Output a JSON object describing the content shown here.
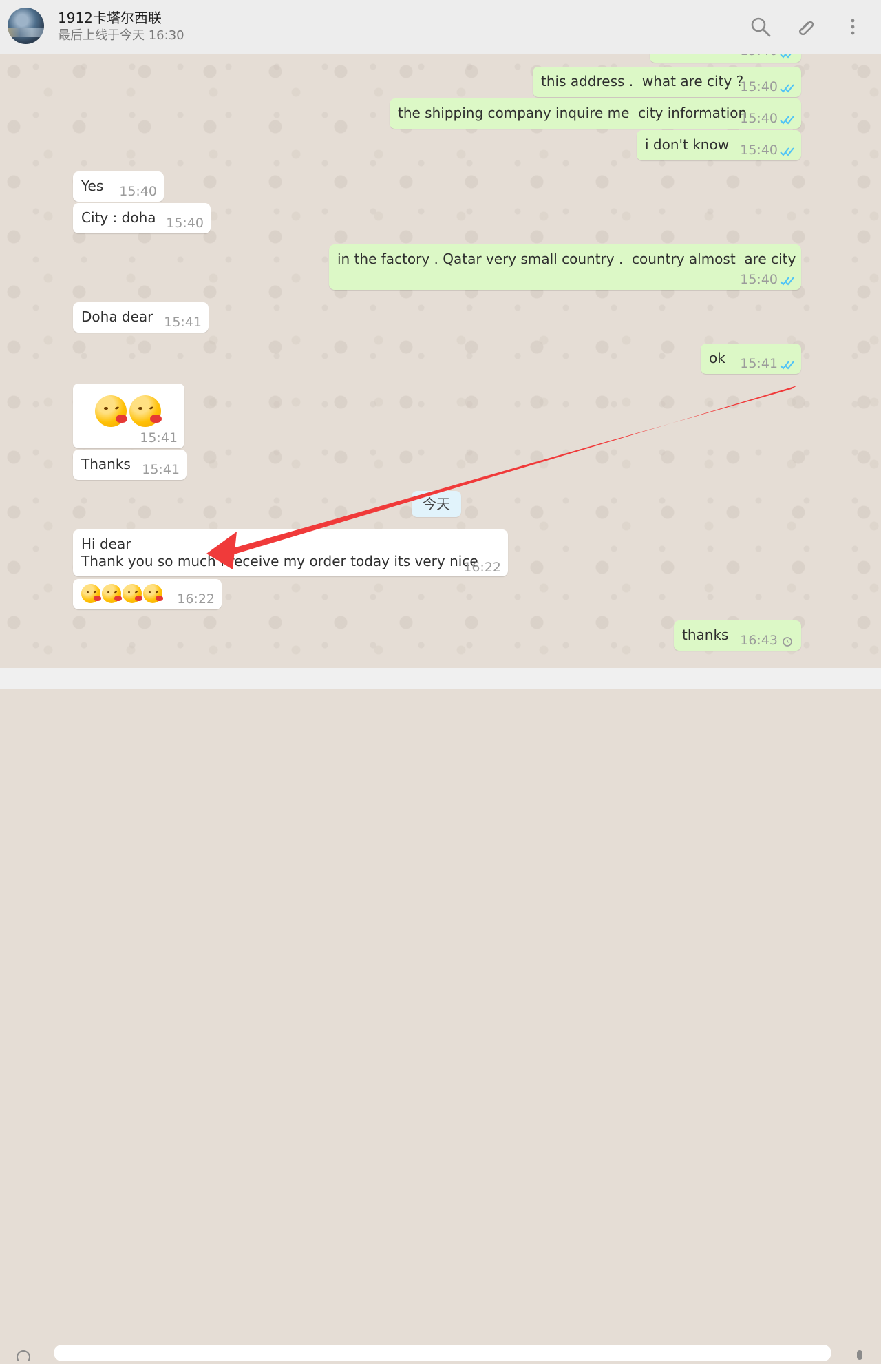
{
  "header": {
    "contact_name": "1912卡塔尔西联",
    "status": "最后上线于今天 16:30",
    "icons": [
      "search-icon",
      "paperclip-icon",
      "more-vertical-icon"
    ]
  },
  "messages": [
    {
      "direction": "outgoing",
      "text": "this address .  what are city ?",
      "time": "15:40",
      "status": "read"
    },
    {
      "direction": "outgoing",
      "text": "the shipping company inquire me  city information",
      "time": "15:40",
      "status": "read"
    },
    {
      "direction": "outgoing",
      "text": "i don't know",
      "time": "15:40",
      "status": "read"
    },
    {
      "direction": "incoming",
      "text": "Yes",
      "time": "15:40"
    },
    {
      "direction": "incoming",
      "text": "City : doha",
      "time": "15:40"
    },
    {
      "direction": "outgoing",
      "text": "in the factory . Qatar very small country .  country almost  are city",
      "time": "15:40",
      "status": "read"
    },
    {
      "direction": "incoming",
      "text": "Doha dear",
      "time": "15:41"
    },
    {
      "direction": "outgoing",
      "text": "ok",
      "time": "15:41",
      "status": "read"
    },
    {
      "direction": "incoming",
      "text": "",
      "time": "15:41",
      "emoji": "kissing-face-emoji x2"
    },
    {
      "direction": "incoming",
      "text": "Thanks",
      "time": "15:41"
    },
    {
      "direction": "incoming",
      "line1": "Hi dear",
      "line2": "Thank you so much I receive my order today its very nice",
      "time": "16:22"
    },
    {
      "direction": "incoming",
      "text": "",
      "time": "16:22",
      "emoji": "kissing-face-emoji x4"
    },
    {
      "direction": "outgoing",
      "text": "thanks",
      "time": "16:43",
      "status": "pending"
    }
  ],
  "day_divider": "今天",
  "colors": {
    "chat_background": "#e5ddd5",
    "outgoing_bubble": "#dcf8c6",
    "incoming_bubble": "#ffffff",
    "read_tick": "#4fc3f7",
    "annotation_arrow": "#f03a3a"
  }
}
